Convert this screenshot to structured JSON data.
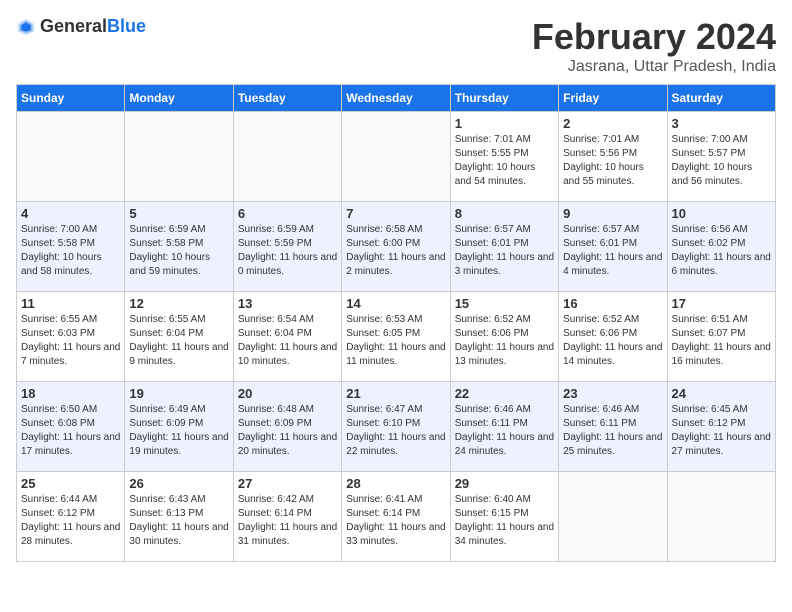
{
  "header": {
    "logo_general": "General",
    "logo_blue": "Blue",
    "month_title": "February 2024",
    "location": "Jasrana, Uttar Pradesh, India"
  },
  "days_of_week": [
    "Sunday",
    "Monday",
    "Tuesday",
    "Wednesday",
    "Thursday",
    "Friday",
    "Saturday"
  ],
  "weeks": [
    [
      {
        "day": "",
        "info": ""
      },
      {
        "day": "",
        "info": ""
      },
      {
        "day": "",
        "info": ""
      },
      {
        "day": "",
        "info": ""
      },
      {
        "day": "1",
        "info": "Sunrise: 7:01 AM\nSunset: 5:55 PM\nDaylight: 10 hours\nand 54 minutes."
      },
      {
        "day": "2",
        "info": "Sunrise: 7:01 AM\nSunset: 5:56 PM\nDaylight: 10 hours\nand 55 minutes."
      },
      {
        "day": "3",
        "info": "Sunrise: 7:00 AM\nSunset: 5:57 PM\nDaylight: 10 hours\nand 56 minutes."
      }
    ],
    [
      {
        "day": "4",
        "info": "Sunrise: 7:00 AM\nSunset: 5:58 PM\nDaylight: 10 hours\nand 58 minutes."
      },
      {
        "day": "5",
        "info": "Sunrise: 6:59 AM\nSunset: 5:58 PM\nDaylight: 10 hours\nand 59 minutes."
      },
      {
        "day": "6",
        "info": "Sunrise: 6:59 AM\nSunset: 5:59 PM\nDaylight: 11 hours\nand 0 minutes."
      },
      {
        "day": "7",
        "info": "Sunrise: 6:58 AM\nSunset: 6:00 PM\nDaylight: 11 hours\nand 2 minutes."
      },
      {
        "day": "8",
        "info": "Sunrise: 6:57 AM\nSunset: 6:01 PM\nDaylight: 11 hours\nand 3 minutes."
      },
      {
        "day": "9",
        "info": "Sunrise: 6:57 AM\nSunset: 6:01 PM\nDaylight: 11 hours\nand 4 minutes."
      },
      {
        "day": "10",
        "info": "Sunrise: 6:56 AM\nSunset: 6:02 PM\nDaylight: 11 hours\nand 6 minutes."
      }
    ],
    [
      {
        "day": "11",
        "info": "Sunrise: 6:55 AM\nSunset: 6:03 PM\nDaylight: 11 hours\nand 7 minutes."
      },
      {
        "day": "12",
        "info": "Sunrise: 6:55 AM\nSunset: 6:04 PM\nDaylight: 11 hours\nand 9 minutes."
      },
      {
        "day": "13",
        "info": "Sunrise: 6:54 AM\nSunset: 6:04 PM\nDaylight: 11 hours\nand 10 minutes."
      },
      {
        "day": "14",
        "info": "Sunrise: 6:53 AM\nSunset: 6:05 PM\nDaylight: 11 hours\nand 11 minutes."
      },
      {
        "day": "15",
        "info": "Sunrise: 6:52 AM\nSunset: 6:06 PM\nDaylight: 11 hours\nand 13 minutes."
      },
      {
        "day": "16",
        "info": "Sunrise: 6:52 AM\nSunset: 6:06 PM\nDaylight: 11 hours\nand 14 minutes."
      },
      {
        "day": "17",
        "info": "Sunrise: 6:51 AM\nSunset: 6:07 PM\nDaylight: 11 hours\nand 16 minutes."
      }
    ],
    [
      {
        "day": "18",
        "info": "Sunrise: 6:50 AM\nSunset: 6:08 PM\nDaylight: 11 hours\nand 17 minutes."
      },
      {
        "day": "19",
        "info": "Sunrise: 6:49 AM\nSunset: 6:09 PM\nDaylight: 11 hours\nand 19 minutes."
      },
      {
        "day": "20",
        "info": "Sunrise: 6:48 AM\nSunset: 6:09 PM\nDaylight: 11 hours\nand 20 minutes."
      },
      {
        "day": "21",
        "info": "Sunrise: 6:47 AM\nSunset: 6:10 PM\nDaylight: 11 hours\nand 22 minutes."
      },
      {
        "day": "22",
        "info": "Sunrise: 6:46 AM\nSunset: 6:11 PM\nDaylight: 11 hours\nand 24 minutes."
      },
      {
        "day": "23",
        "info": "Sunrise: 6:46 AM\nSunset: 6:11 PM\nDaylight: 11 hours\nand 25 minutes."
      },
      {
        "day": "24",
        "info": "Sunrise: 6:45 AM\nSunset: 6:12 PM\nDaylight: 11 hours\nand 27 minutes."
      }
    ],
    [
      {
        "day": "25",
        "info": "Sunrise: 6:44 AM\nSunset: 6:12 PM\nDaylight: 11 hours\nand 28 minutes."
      },
      {
        "day": "26",
        "info": "Sunrise: 6:43 AM\nSunset: 6:13 PM\nDaylight: 11 hours\nand 30 minutes."
      },
      {
        "day": "27",
        "info": "Sunrise: 6:42 AM\nSunset: 6:14 PM\nDaylight: 11 hours\nand 31 minutes."
      },
      {
        "day": "28",
        "info": "Sunrise: 6:41 AM\nSunset: 6:14 PM\nDaylight: 11 hours\nand 33 minutes."
      },
      {
        "day": "29",
        "info": "Sunrise: 6:40 AM\nSunset: 6:15 PM\nDaylight: 11 hours\nand 34 minutes."
      },
      {
        "day": "",
        "info": ""
      },
      {
        "day": "",
        "info": ""
      }
    ]
  ]
}
